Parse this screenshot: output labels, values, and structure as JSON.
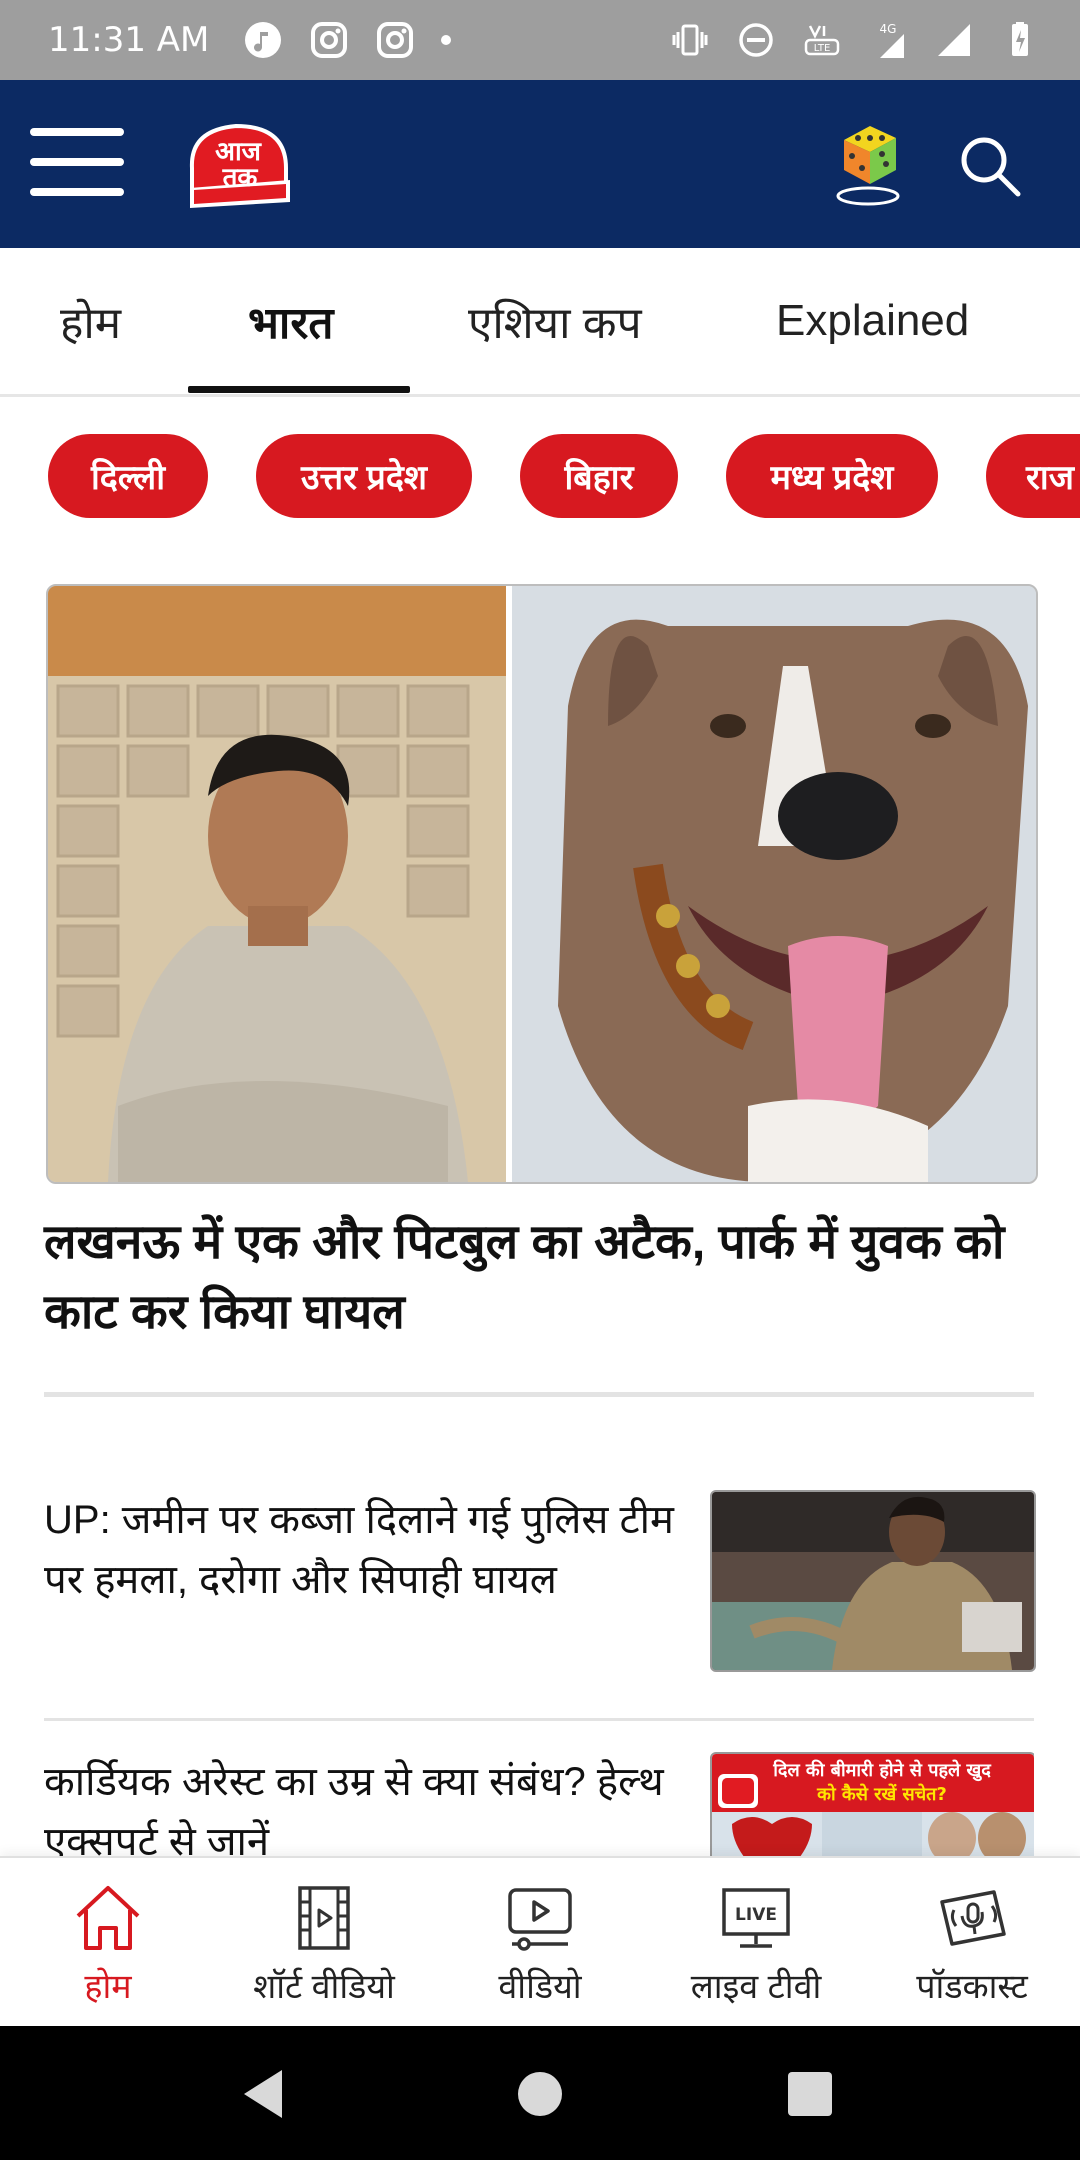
{
  "status_bar": {
    "time": "11:31 AM",
    "network": "4G"
  },
  "header": {
    "logo_text_top": "आज",
    "logo_text_bottom": "तक"
  },
  "tabs": [
    {
      "label": "होम"
    },
    {
      "label": "भारत",
      "active": true
    },
    {
      "label": "एशिया कप"
    },
    {
      "label": "Explained"
    }
  ],
  "chips": [
    {
      "label": "दिल्ली"
    },
    {
      "label": "उत्तर प्रदेश"
    },
    {
      "label": "बिहार"
    },
    {
      "label": "मध्य प्रदेश"
    },
    {
      "label": "राज"
    }
  ],
  "hero": {
    "title": "लखनऊ में एक और पिटबुल का अटैक, पार्क में युवक को काट कर किया घायल"
  },
  "stories": [
    {
      "title": "UP: जमीन पर कब्जा दिलाने गई पुलिस टीम पर हमला, दरोगा और सिपाही घायल"
    },
    {
      "title": "कार्डियक अरेस्ट का उम्र से क्या संबंध? हेल्थ एक्सपर्ट से जानें",
      "thumb_caption_1": "दिल की बीमारी होने से पहले खुद",
      "thumb_caption_2": "को कैसे रखें सचेत?"
    }
  ],
  "bottom_nav": [
    {
      "label": "होम",
      "icon": "home-icon",
      "active": true
    },
    {
      "label": "शॉर्ट वीडियो",
      "icon": "film-icon"
    },
    {
      "label": "वीडियो",
      "icon": "video-icon"
    },
    {
      "label": "लाइव टीवी",
      "icon": "live-tv-icon",
      "badge": "LIVE"
    },
    {
      "label": "पॉडकास्ट",
      "icon": "podcast-icon"
    }
  ],
  "colors": {
    "brand_navy": "#0c2a63",
    "accent_red": "#d71920"
  }
}
